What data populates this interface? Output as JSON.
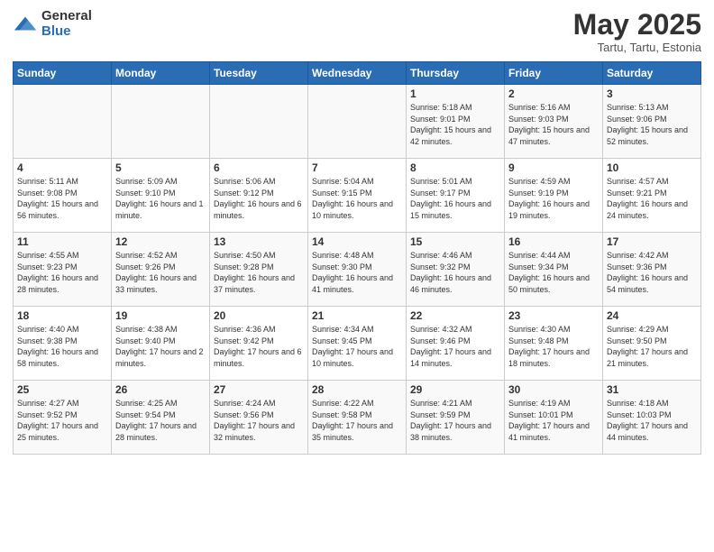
{
  "logo": {
    "general": "General",
    "blue": "Blue"
  },
  "title": "May 2025",
  "subtitle": "Tartu, Tartu, Estonia",
  "days_of_week": [
    "Sunday",
    "Monday",
    "Tuesday",
    "Wednesday",
    "Thursday",
    "Friday",
    "Saturday"
  ],
  "weeks": [
    [
      {
        "day": "",
        "info": ""
      },
      {
        "day": "",
        "info": ""
      },
      {
        "day": "",
        "info": ""
      },
      {
        "day": "",
        "info": ""
      },
      {
        "day": "1",
        "info": "Sunrise: 5:18 AM\nSunset: 9:01 PM\nDaylight: 15 hours\nand 42 minutes."
      },
      {
        "day": "2",
        "info": "Sunrise: 5:16 AM\nSunset: 9:03 PM\nDaylight: 15 hours\nand 47 minutes."
      },
      {
        "day": "3",
        "info": "Sunrise: 5:13 AM\nSunset: 9:06 PM\nDaylight: 15 hours\nand 52 minutes."
      }
    ],
    [
      {
        "day": "4",
        "info": "Sunrise: 5:11 AM\nSunset: 9:08 PM\nDaylight: 15 hours\nand 56 minutes."
      },
      {
        "day": "5",
        "info": "Sunrise: 5:09 AM\nSunset: 9:10 PM\nDaylight: 16 hours\nand 1 minute."
      },
      {
        "day": "6",
        "info": "Sunrise: 5:06 AM\nSunset: 9:12 PM\nDaylight: 16 hours\nand 6 minutes."
      },
      {
        "day": "7",
        "info": "Sunrise: 5:04 AM\nSunset: 9:15 PM\nDaylight: 16 hours\nand 10 minutes."
      },
      {
        "day": "8",
        "info": "Sunrise: 5:01 AM\nSunset: 9:17 PM\nDaylight: 16 hours\nand 15 minutes."
      },
      {
        "day": "9",
        "info": "Sunrise: 4:59 AM\nSunset: 9:19 PM\nDaylight: 16 hours\nand 19 minutes."
      },
      {
        "day": "10",
        "info": "Sunrise: 4:57 AM\nSunset: 9:21 PM\nDaylight: 16 hours\nand 24 minutes."
      }
    ],
    [
      {
        "day": "11",
        "info": "Sunrise: 4:55 AM\nSunset: 9:23 PM\nDaylight: 16 hours\nand 28 minutes."
      },
      {
        "day": "12",
        "info": "Sunrise: 4:52 AM\nSunset: 9:26 PM\nDaylight: 16 hours\nand 33 minutes."
      },
      {
        "day": "13",
        "info": "Sunrise: 4:50 AM\nSunset: 9:28 PM\nDaylight: 16 hours\nand 37 minutes."
      },
      {
        "day": "14",
        "info": "Sunrise: 4:48 AM\nSunset: 9:30 PM\nDaylight: 16 hours\nand 41 minutes."
      },
      {
        "day": "15",
        "info": "Sunrise: 4:46 AM\nSunset: 9:32 PM\nDaylight: 16 hours\nand 46 minutes."
      },
      {
        "day": "16",
        "info": "Sunrise: 4:44 AM\nSunset: 9:34 PM\nDaylight: 16 hours\nand 50 minutes."
      },
      {
        "day": "17",
        "info": "Sunrise: 4:42 AM\nSunset: 9:36 PM\nDaylight: 16 hours\nand 54 minutes."
      }
    ],
    [
      {
        "day": "18",
        "info": "Sunrise: 4:40 AM\nSunset: 9:38 PM\nDaylight: 16 hours\nand 58 minutes."
      },
      {
        "day": "19",
        "info": "Sunrise: 4:38 AM\nSunset: 9:40 PM\nDaylight: 17 hours\nand 2 minutes."
      },
      {
        "day": "20",
        "info": "Sunrise: 4:36 AM\nSunset: 9:42 PM\nDaylight: 17 hours\nand 6 minutes."
      },
      {
        "day": "21",
        "info": "Sunrise: 4:34 AM\nSunset: 9:45 PM\nDaylight: 17 hours\nand 10 minutes."
      },
      {
        "day": "22",
        "info": "Sunrise: 4:32 AM\nSunset: 9:46 PM\nDaylight: 17 hours\nand 14 minutes."
      },
      {
        "day": "23",
        "info": "Sunrise: 4:30 AM\nSunset: 9:48 PM\nDaylight: 17 hours\nand 18 minutes."
      },
      {
        "day": "24",
        "info": "Sunrise: 4:29 AM\nSunset: 9:50 PM\nDaylight: 17 hours\nand 21 minutes."
      }
    ],
    [
      {
        "day": "25",
        "info": "Sunrise: 4:27 AM\nSunset: 9:52 PM\nDaylight: 17 hours\nand 25 minutes."
      },
      {
        "day": "26",
        "info": "Sunrise: 4:25 AM\nSunset: 9:54 PM\nDaylight: 17 hours\nand 28 minutes."
      },
      {
        "day": "27",
        "info": "Sunrise: 4:24 AM\nSunset: 9:56 PM\nDaylight: 17 hours\nand 32 minutes."
      },
      {
        "day": "28",
        "info": "Sunrise: 4:22 AM\nSunset: 9:58 PM\nDaylight: 17 hours\nand 35 minutes."
      },
      {
        "day": "29",
        "info": "Sunrise: 4:21 AM\nSunset: 9:59 PM\nDaylight: 17 hours\nand 38 minutes."
      },
      {
        "day": "30",
        "info": "Sunrise: 4:19 AM\nSunset: 10:01 PM\nDaylight: 17 hours\nand 41 minutes."
      },
      {
        "day": "31",
        "info": "Sunrise: 4:18 AM\nSunset: 10:03 PM\nDaylight: 17 hours\nand 44 minutes."
      }
    ]
  ]
}
